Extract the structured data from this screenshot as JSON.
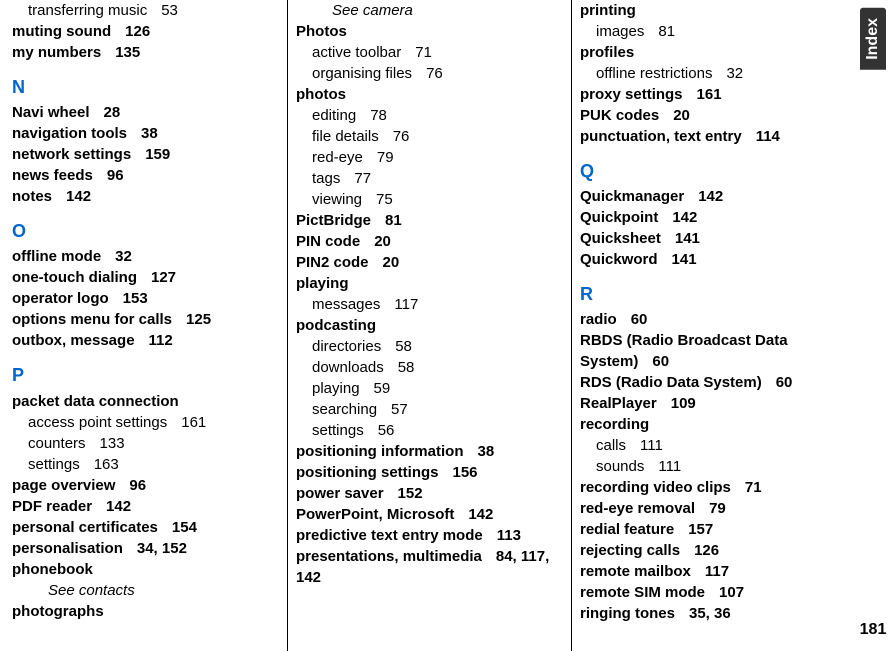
{
  "sidebar": {
    "label": "Index",
    "page_number": "181"
  },
  "column1": {
    "entries": [
      {
        "text": "transferring music",
        "pages": "53",
        "bold": false,
        "indent": 1
      },
      {
        "text": "muting sound",
        "pages": "126",
        "bold": true
      },
      {
        "text": "my numbers",
        "pages": "135",
        "bold": true
      }
    ],
    "letter_N": "N",
    "entries_N": [
      {
        "text": "Navi wheel",
        "pages": "28",
        "bold": true
      },
      {
        "text": "navigation tools",
        "pages": "38",
        "bold": true
      },
      {
        "text": "network settings",
        "pages": "159",
        "bold": true
      },
      {
        "text": "news feeds",
        "pages": "96",
        "bold": true
      },
      {
        "text": "notes",
        "pages": "142",
        "bold": true
      }
    ],
    "letter_O": "O",
    "entries_O": [
      {
        "text": "offline mode",
        "pages": "32",
        "bold": true
      },
      {
        "text": "one-touch dialing",
        "pages": "127",
        "bold": true
      },
      {
        "text": "operator logo",
        "pages": "153",
        "bold": true
      },
      {
        "text": "options menu for calls",
        "pages": "125",
        "bold": true
      },
      {
        "text": "outbox, message",
        "pages": "112",
        "bold": true
      }
    ],
    "letter_P": "P",
    "entries_P": [
      {
        "text": "packet data connection",
        "pages": "",
        "bold": true
      },
      {
        "text": "access point settings",
        "pages": "161",
        "bold": false,
        "indent": 1
      },
      {
        "text": "counters",
        "pages": "133",
        "bold": false,
        "indent": 1
      },
      {
        "text": "settings",
        "pages": "163",
        "bold": false,
        "indent": 1
      },
      {
        "text": "page overview",
        "pages": "96",
        "bold": true
      },
      {
        "text": "PDF reader",
        "pages": "142",
        "bold": true
      },
      {
        "text": "personal certificates",
        "pages": "154",
        "bold": true
      },
      {
        "text": "personalisation",
        "pages": "34, 152",
        "bold": true
      },
      {
        "text": "phonebook",
        "pages": "",
        "bold": true
      },
      {
        "see": "contacts"
      },
      {
        "text": "photographs",
        "pages": "",
        "bold": true
      }
    ]
  },
  "column2": {
    "entries": [
      {
        "see": "camera"
      },
      {
        "text": "Photos",
        "pages": "",
        "bold": true
      },
      {
        "text": "active toolbar",
        "pages": "71",
        "bold": false,
        "indent": 1
      },
      {
        "text": "organising files",
        "pages": "76",
        "bold": false,
        "indent": 1
      },
      {
        "text": "photos",
        "pages": "",
        "bold": true
      },
      {
        "text": "editing",
        "pages": "78",
        "bold": false,
        "indent": 1
      },
      {
        "text": "file details",
        "pages": "76",
        "bold": false,
        "indent": 1
      },
      {
        "text": "red-eye",
        "pages": "79",
        "bold": false,
        "indent": 1
      },
      {
        "text": "tags",
        "pages": "77",
        "bold": false,
        "indent": 1
      },
      {
        "text": "viewing",
        "pages": "75",
        "bold": false,
        "indent": 1
      },
      {
        "text": "PictBridge",
        "pages": "81",
        "bold": true
      },
      {
        "text": "PIN code",
        "pages": "20",
        "bold": true
      },
      {
        "text": "PIN2 code",
        "pages": "20",
        "bold": true
      },
      {
        "text": "playing",
        "pages": "",
        "bold": true
      },
      {
        "text": "messages",
        "pages": "117",
        "bold": false,
        "indent": 1
      },
      {
        "text": "podcasting",
        "pages": "",
        "bold": true
      },
      {
        "text": "directories",
        "pages": "58",
        "bold": false,
        "indent": 1
      },
      {
        "text": "downloads",
        "pages": "58",
        "bold": false,
        "indent": 1
      },
      {
        "text": "playing",
        "pages": "59",
        "bold": false,
        "indent": 1
      },
      {
        "text": "searching",
        "pages": "57",
        "bold": false,
        "indent": 1
      },
      {
        "text": "settings",
        "pages": "56",
        "bold": false,
        "indent": 1
      },
      {
        "text": "positioning information",
        "pages": "38",
        "bold": true
      },
      {
        "text": "positioning settings",
        "pages": "156",
        "bold": true
      },
      {
        "text": "power saver",
        "pages": "152",
        "bold": true
      },
      {
        "text": "PowerPoint, Microsoft",
        "pages": "142",
        "bold": true
      },
      {
        "text": "predictive text entry mode",
        "pages": "113",
        "bold": true
      },
      {
        "text": "presentations, multimedia",
        "pages": "84, 117, 142",
        "bold": true
      }
    ]
  },
  "column3": {
    "entries": [
      {
        "text": "printing",
        "pages": "",
        "bold": true
      },
      {
        "text": "images",
        "pages": "81",
        "bold": false,
        "indent": 1
      },
      {
        "text": "profiles",
        "pages": "",
        "bold": true
      },
      {
        "text": "offline restrictions",
        "pages": "32",
        "bold": false,
        "indent": 1
      },
      {
        "text": "proxy settings",
        "pages": "161",
        "bold": true
      },
      {
        "text": "PUK codes",
        "pages": "20",
        "bold": true
      },
      {
        "text": "punctuation, text entry",
        "pages": "114",
        "bold": true
      }
    ],
    "letter_Q": "Q",
    "entries_Q": [
      {
        "text": "Quickmanager",
        "pages": "142",
        "bold": true
      },
      {
        "text": "Quickpoint",
        "pages": "142",
        "bold": true
      },
      {
        "text": "Quicksheet",
        "pages": "141",
        "bold": true
      },
      {
        "text": "Quickword",
        "pages": "141",
        "bold": true
      }
    ],
    "letter_R": "R",
    "entries_R": [
      {
        "text": "radio",
        "pages": "60",
        "bold": true
      },
      {
        "text": "RBDS (Radio Broadcast Data System)",
        "pages": "60",
        "bold": true
      },
      {
        "text": "RDS (Radio Data System)",
        "pages": "60",
        "bold": true
      },
      {
        "text": "RealPlayer",
        "pages": "109",
        "bold": true
      },
      {
        "text": "recording",
        "pages": "",
        "bold": true
      },
      {
        "text": "calls",
        "pages": "111",
        "bold": false,
        "indent": 1
      },
      {
        "text": "sounds",
        "pages": "111",
        "bold": false,
        "indent": 1
      },
      {
        "text": "recording video clips",
        "pages": "71",
        "bold": true
      },
      {
        "text": "red-eye removal",
        "pages": "79",
        "bold": true
      },
      {
        "text": "redial feature",
        "pages": "157",
        "bold": true
      },
      {
        "text": "rejecting calls",
        "pages": "126",
        "bold": true
      },
      {
        "text": "remote mailbox",
        "pages": "117",
        "bold": true
      },
      {
        "text": "remote SIM mode",
        "pages": "107",
        "bold": true
      },
      {
        "text": "ringing tones",
        "pages": "35, 36",
        "bold": true
      }
    ]
  }
}
